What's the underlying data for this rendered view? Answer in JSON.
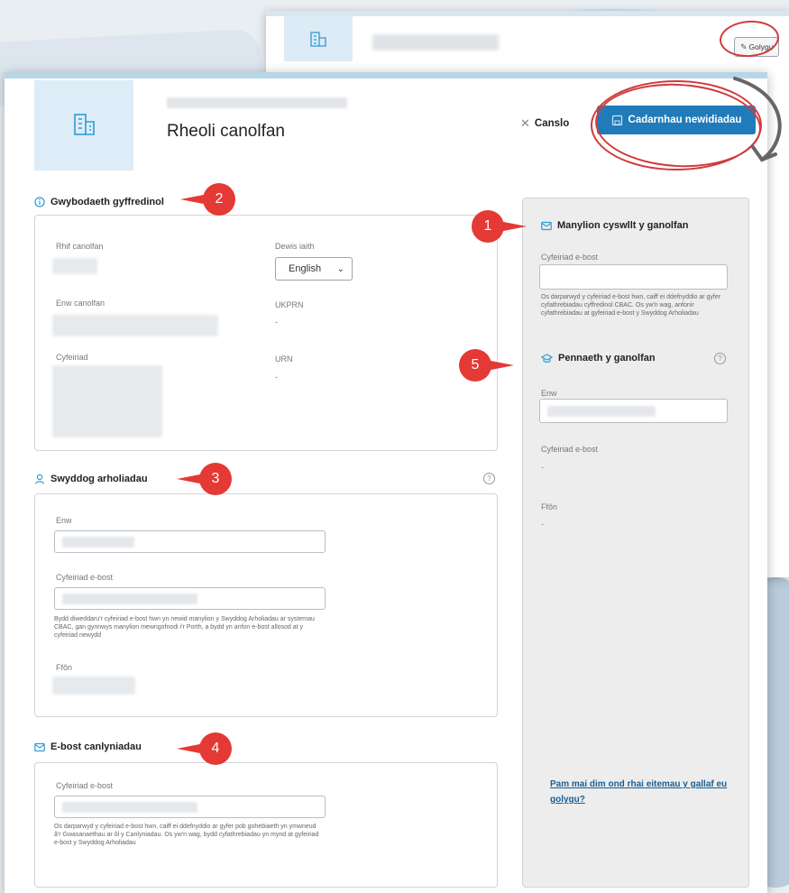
{
  "back_window": {
    "edit_label": "Golygu"
  },
  "dialog": {
    "title": "Rheoli canolfan",
    "cancel_label": "Canslo",
    "confirm_label": "Cadarnhau newidiadau"
  },
  "general": {
    "title": "Gwybodaeth gyffredinol",
    "centre_number_label": "Rhif canolfan",
    "language_label": "Dewis iaith",
    "language_value": "English",
    "centre_name_label": "Enw canolfan",
    "ukprn_label": "UKPRN",
    "ukprn_value": "-",
    "address_label": "Cyfeiriad",
    "urn_label": "URN",
    "urn_value": "-"
  },
  "exams_officer": {
    "title": "Swyddog arholiadau",
    "name_label": "Enw",
    "email_label": "Cyfeiriad e-bost",
    "email_help": "Bydd diweddaru'r cyfeiriad e-bost hwn yn newid manylion y Swyddog Arholiadau ar systemau CBAC, gan gynnwys manylion mewngofnodi i'r Porth, a bydd yn anfon e-bost allosod at y cyfeiriad newydd",
    "phone_label": "Ffôn"
  },
  "results_email": {
    "title": "E-bost canlyniadau",
    "email_label": "Cyfeiriad e-bost",
    "email_help": "Os darparwyd y cyfeiriad e-bost hwn, caiff ei ddefnyddio ar gyfer pob gohebiaeth yn ymwneud â'r Gwasanaethau ar ôl y Canlyniadau. Os yw'n wag, bydd cyfathrebiadau yn mynd at gyfeiriad e-bost y Swyddog Arholiadau"
  },
  "contact": {
    "title": "Manylion cyswllt y ganolfan",
    "email_label": "Cyfeiriad e-bost",
    "email_help": "Os darparwyd y cyfeiriad e-bost hwn, caiff ei ddefnyddio ar gyfer cyfathrebiadau cyffredinol CBAC. Os yw'n wag, anfonir cyfathrebiadau at gyfeiriad e-bost y Swyddog Arholiadau"
  },
  "head": {
    "title": "Pennaeth y ganolfan",
    "name_label": "Enw",
    "email_label": "Cyfeiriad e-bost",
    "email_value": "-",
    "phone_label": "Ffôn",
    "phone_value": "-"
  },
  "side_link": "Pam mai dim ond rhai eitemau y gallaf eu golygu?",
  "callouts": [
    "1",
    "2",
    "3",
    "4",
    "5"
  ],
  "colors": {
    "accent": "#1f7bb9",
    "icon": "#2e9bd6",
    "annotation_red": "#e53935",
    "link": "#1a5f93"
  }
}
